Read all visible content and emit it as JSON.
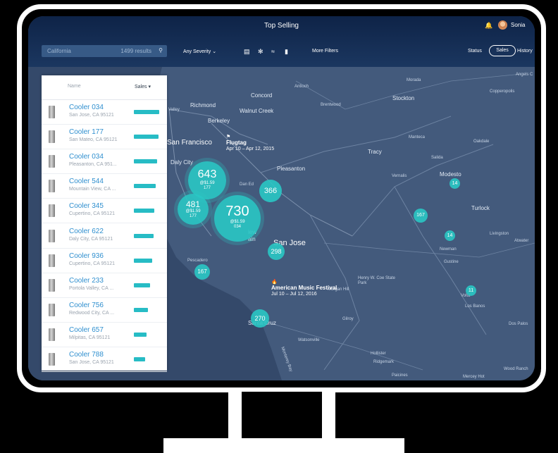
{
  "app": {
    "title": "Top Selling",
    "user": "Sonia"
  },
  "search": {
    "placeholder": "California",
    "results": "1499 results"
  },
  "filters": {
    "severity": "Any Severity",
    "more": "More Filters",
    "icons": [
      "car-icon",
      "fan-icon",
      "wifi-icon",
      "battery-icon"
    ]
  },
  "view_toggle": {
    "status": "Status",
    "sales": "Sales",
    "history": "History"
  },
  "list": {
    "header": {
      "name": "Name",
      "sales": "Sales ▾"
    },
    "items": [
      {
        "name": "Cooler 034",
        "address": "San Jose, CA 95121",
        "sales_level": 1.0
      },
      {
        "name": "Cooler 177",
        "address": "San Mateo, CA 95121",
        "sales_level": 0.97
      },
      {
        "name": "Cooler 034",
        "address": "Pleasanton, CA 951...",
        "sales_level": 0.92
      },
      {
        "name": "Cooler 544",
        "address": "Mountain View, CA ...",
        "sales_level": 0.86
      },
      {
        "name": "Cooler 345",
        "address": "Cupertino, CA 95121",
        "sales_level": 0.8
      },
      {
        "name": "Cooler 622",
        "address": "Daly City, CA 95121",
        "sales_level": 0.77
      },
      {
        "name": "Cooler 936",
        "address": "Cupertino, CA 95121",
        "sales_level": 0.72
      },
      {
        "name": "Cooler 233",
        "address": "Portola Valley, CA ...",
        "sales_level": 0.63
      },
      {
        "name": "Cooler 756",
        "address": "Redwood City, CA ...",
        "sales_level": 0.55
      },
      {
        "name": "Cooler 657",
        "address": "Milpitas, CA 95121",
        "sales_level": 0.5
      },
      {
        "name": "Cooler 788",
        "address": "San Jose, CA 95121",
        "sales_level": 0.45
      }
    ]
  },
  "map": {
    "labels": [
      "Angels C",
      "Copperopolis",
      "Morada",
      "Stockton",
      "Antioch",
      "Concord",
      "Richmond",
      "Walnut Creek",
      "Brentwood",
      "Berkeley",
      "Valley",
      "San Francisco",
      "Manteca",
      "Oakdale",
      "Tracy",
      "Daly City",
      "Pleasanton",
      "Vernalis",
      "Salida",
      "Modesto",
      "Turlock",
      "Livingston",
      "Atwater",
      "Newman",
      "Gustine",
      "Pescadero",
      "San Jose",
      "Morgan Hill",
      "Henry W. Coe State Park",
      "Volta",
      "Los Banos",
      "Gilroy",
      "Dos Palos",
      "Watsonville",
      "Hollister",
      "Ridgemark",
      "Paicines",
      "Mercey Hot",
      "Wood Ranch",
      "Monterey Bay",
      "Santa Cruz",
      "ain",
      "iew",
      "Dan Ed"
    ],
    "events": [
      {
        "title": "Flugtag",
        "dates": "Apr 10 – Apr 12, 2015"
      },
      {
        "title": "American Music Festival",
        "dates": "Jul 10 – Jul 12, 2016"
      }
    ],
    "clusters": [
      {
        "count": "643",
        "price": "@$1.59",
        "id": "177"
      },
      {
        "count": "481",
        "price": "@$1.59",
        "id": "177"
      },
      {
        "count": "730",
        "price": "@$1.59",
        "id": "034"
      }
    ],
    "pins": [
      "366",
      "298",
      "167",
      "270",
      "167",
      "14",
      "14",
      "11"
    ]
  }
}
